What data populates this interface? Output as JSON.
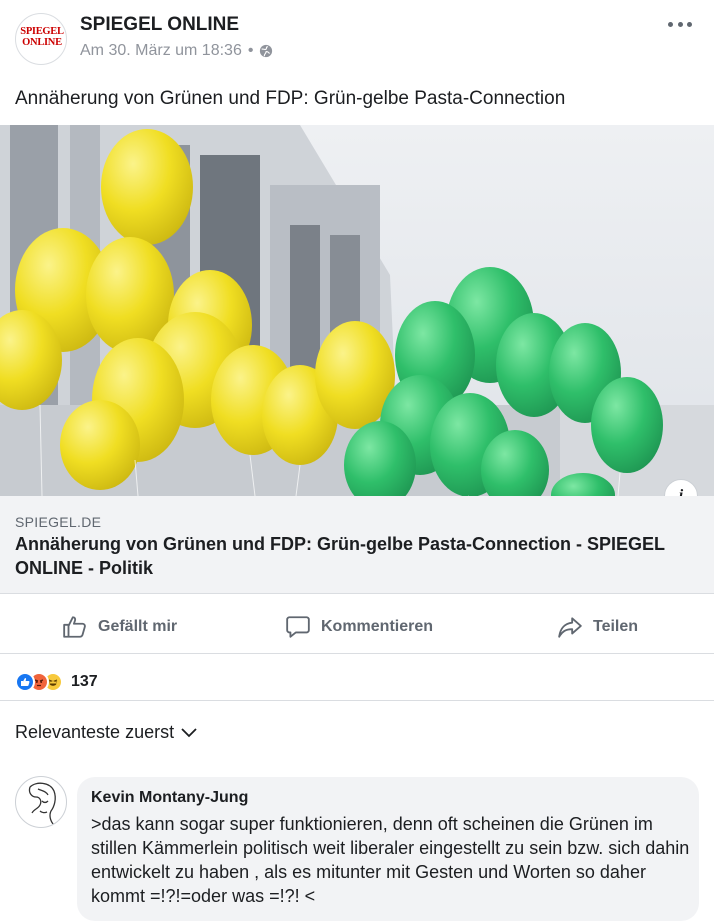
{
  "post": {
    "page_name": "SPIEGEL ONLINE",
    "logo_text": "SPIEGEL ONLINE",
    "timestamp": "Am 30. März um 18:36",
    "separator": "•",
    "privacy_icon": "globe-icon",
    "menu_icon": "more-dots-icon",
    "text": "Annäherung von Grünen und FDP: Grün-gelbe Pasta-Connection"
  },
  "link": {
    "image_alt": "Gelbe und grüne Luftballons vor einem Gebäude",
    "domain": "SPIEGEL.DE",
    "title": "Annäherung von Grünen und FDP: Grün-gelbe Pasta-Connection - SPIEGEL ONLINE - Politik",
    "info_icon": "info-icon"
  },
  "actions": {
    "like_label": "Gefällt mir",
    "comment_label": "Kommentieren",
    "share_label": "Teilen"
  },
  "reactions": {
    "types": [
      "like",
      "angry",
      "haha"
    ],
    "count": "137"
  },
  "comments": {
    "sort_label": "Relevanteste zuerst",
    "items": [
      {
        "author": "Kevin Montany-Jung",
        "text": ">das kann sogar super funktionieren, denn oft scheinen die Grünen  im stillen Kämmerlein politisch weit liberaler eingestellt zu sein bzw. sich dahin entwickelt zu haben , als es mitunter mit Gesten und Worten so  daher kommt =!?!=oder was =!?! <"
      }
    ]
  },
  "colors": {
    "accent": "#1877f2",
    "balloon_yellow": "#f3e22a",
    "balloon_green": "#2fbf6a",
    "muted_text": "#606770",
    "bubble_bg": "#f2f3f5"
  }
}
